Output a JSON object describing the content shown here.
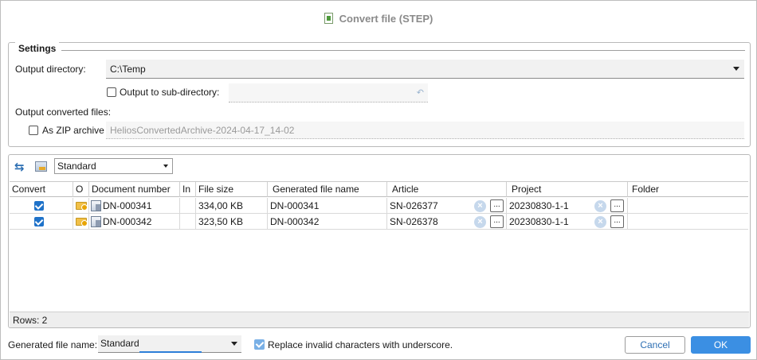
{
  "window": {
    "title": "Convert file (STEP)"
  },
  "settings": {
    "legend": "Settings",
    "output_directory_label": "Output directory:",
    "output_directory_value": "C:\\Temp",
    "subdir_label": "Output to sub-directory:",
    "subdir_checked": false,
    "output_converted_label": "Output converted files:",
    "zip_label": "As ZIP archive",
    "zip_checked": false,
    "zip_value": "HeliosConvertedArchive-2024-04-17_14-02"
  },
  "toolbar": {
    "view_value": "Standard"
  },
  "table": {
    "columns": [
      "Convert",
      "O",
      "Document number",
      "In",
      "File size",
      "Generated file name",
      "Article",
      "Project",
      "Folder"
    ],
    "rows": [
      {
        "convert": true,
        "document_number": "DN-000341",
        "file_size": "334,00 KB",
        "generated_name": "DN-000341",
        "article": "SN-026377",
        "project": "20230830-1-1",
        "folder": ""
      },
      {
        "convert": true,
        "document_number": "DN-000342",
        "file_size": "323,50 KB",
        "generated_name": "DN-000342",
        "article": "SN-026378",
        "project": "20230830-1-1",
        "folder": ""
      }
    ],
    "ellipsis": "...",
    "clear_glyph": "×",
    "rows_label": "Rows: 2"
  },
  "footer": {
    "generated_name_label": "Generated file name:",
    "generated_name_value": "Standard",
    "replace_label": "Replace invalid characters with underscore.",
    "replace_checked": true,
    "cancel_label": "Cancel",
    "ok_label": "OK"
  },
  "colors": {
    "accent": "#3b8fe3",
    "checkbox": "#1f72c9",
    "link": "#2d6fb3"
  }
}
